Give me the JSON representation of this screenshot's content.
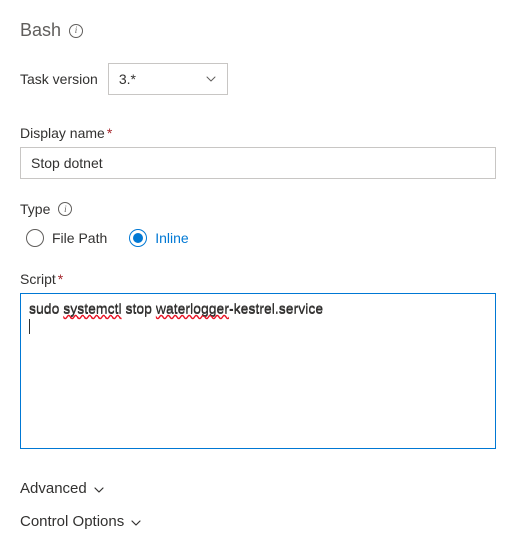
{
  "title": "Bash",
  "taskVersion": {
    "label": "Task version",
    "selected": "3.*"
  },
  "displayName": {
    "label": "Display name",
    "required": "*",
    "value": "Stop dotnet"
  },
  "type": {
    "label": "Type",
    "options": {
      "filePath": "File Path",
      "inline": "Inline"
    },
    "selected": "inline"
  },
  "script": {
    "label": "Script",
    "required": "*",
    "value": "sudo systemctl stop waterlogger-kestrel.service"
  },
  "sections": {
    "advanced": "Advanced",
    "controlOptions": "Control Options"
  }
}
